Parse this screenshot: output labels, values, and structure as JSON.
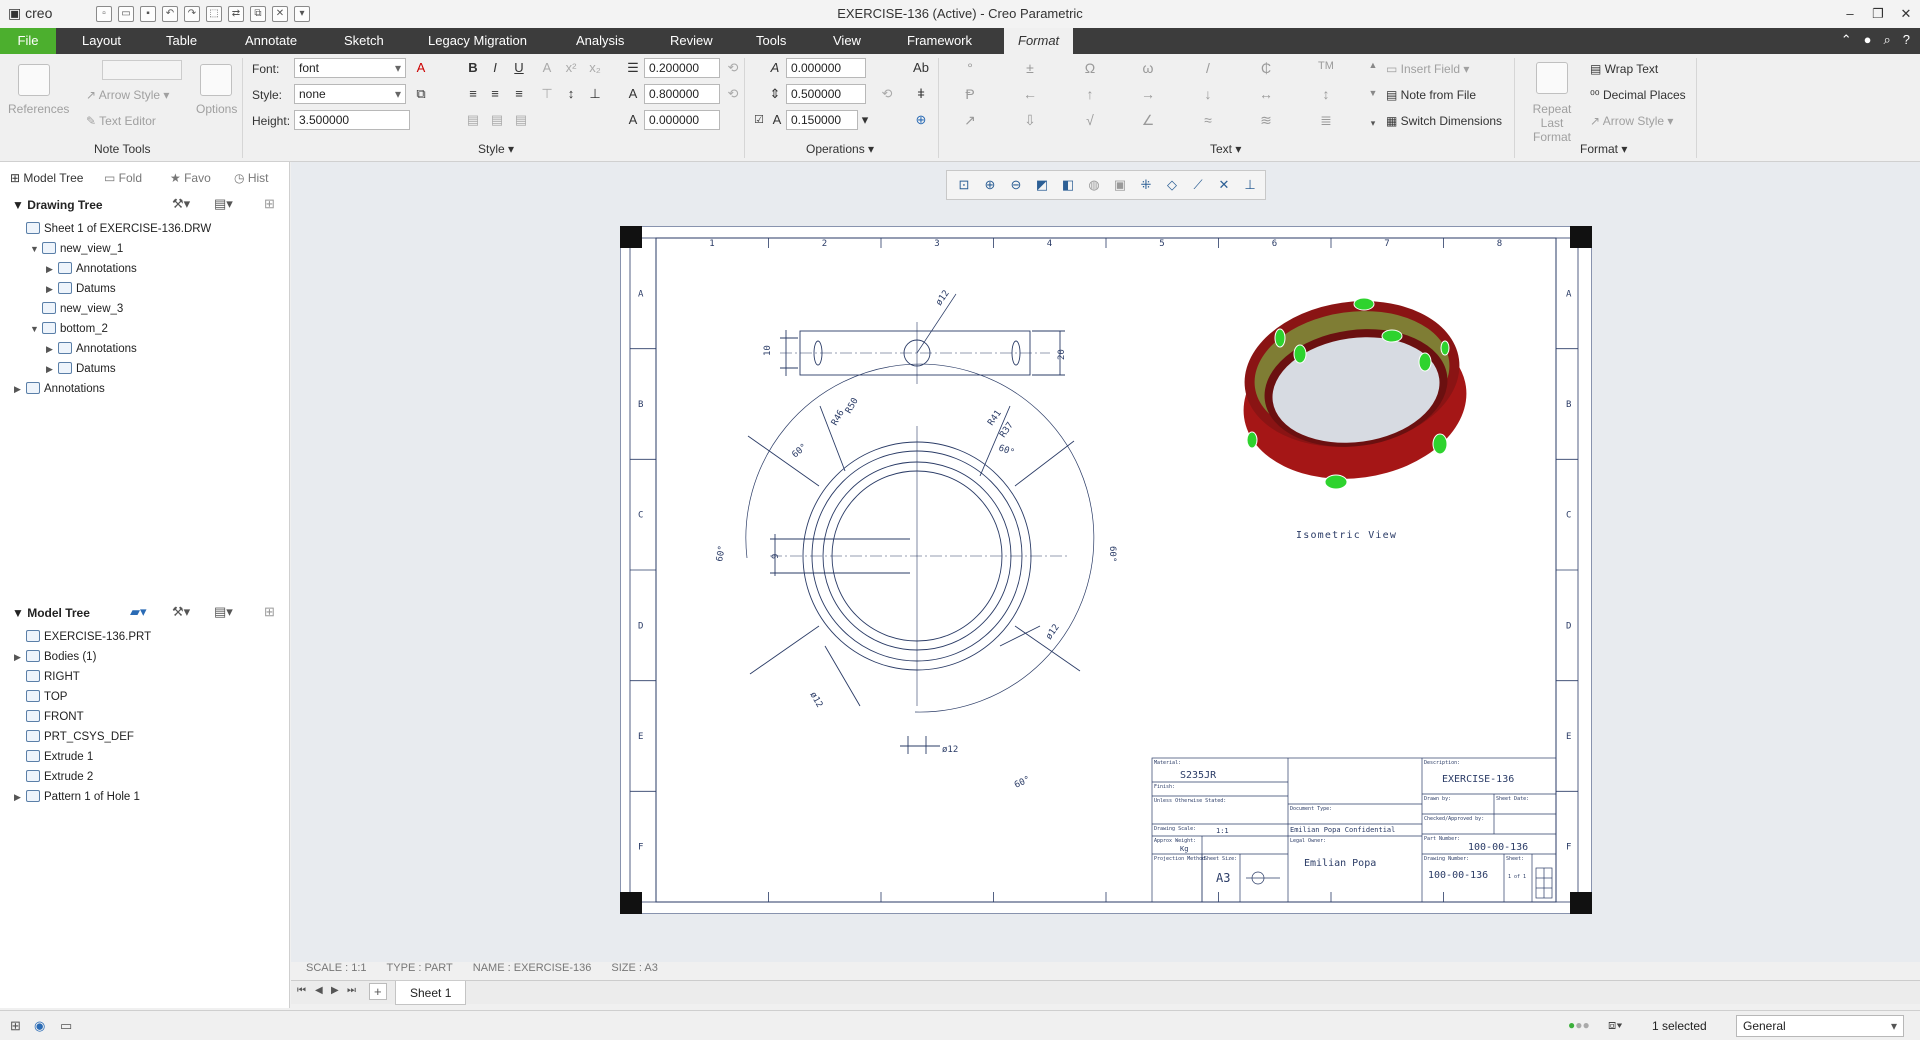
{
  "app": {
    "logo": "creo",
    "title": "EXERCISE-136 (Active) - Creo Parametric"
  },
  "menu": {
    "file": "File",
    "items": [
      "Layout",
      "Table",
      "Annotate",
      "Sketch",
      "Legacy Migration",
      "Analysis",
      "Review",
      "Tools",
      "View",
      "Framework"
    ],
    "active": "Format"
  },
  "ribbon": {
    "note_tools": {
      "label": "Note Tools",
      "references": "References",
      "arrow_style": "Arrow Style",
      "text_editor": "Text Editor",
      "options": "Options"
    },
    "style": {
      "label": "Style",
      "font_label": "Font:",
      "font_value": "font",
      "style_label": "Style:",
      "style_value": "none",
      "height_label": "Height:",
      "height_value": "3.500000"
    },
    "operations": {
      "label": "Operations",
      "thickness": "0.200000",
      "slant": "0.000000",
      "width_factor": "0.800000",
      "line_spacing": "0.500000",
      "char_spacing": "0.000000",
      "underline_offset": "0.150000"
    },
    "text": {
      "label": "Text",
      "insert_field": "Insert Field",
      "note_from_file": "Note from File",
      "switch_dimensions": "Switch Dimensions"
    },
    "format": {
      "label": "Format",
      "repeat_last_format": "Repeat Last Format",
      "wrap_text": "Wrap Text",
      "decimal_places": "Decimal Places",
      "arrow_style": "Arrow Style"
    }
  },
  "left_panel": {
    "tabs": [
      "Model Tree",
      "Fold",
      "Favo",
      "Hist"
    ],
    "drawing_tree": {
      "title": "Drawing Tree",
      "items": [
        {
          "label": "Sheet 1 of EXERCISE-136.DRW",
          "indent": 0,
          "arrow": ""
        },
        {
          "label": "new_view_1",
          "indent": 1,
          "arrow": "▼"
        },
        {
          "label": "Annotations",
          "indent": 2,
          "arrow": "▶"
        },
        {
          "label": "Datums",
          "indent": 2,
          "arrow": "▶"
        },
        {
          "label": "new_view_3",
          "indent": 1,
          "arrow": ""
        },
        {
          "label": "bottom_2",
          "indent": 1,
          "arrow": "▼"
        },
        {
          "label": "Annotations",
          "indent": 2,
          "arrow": "▶"
        },
        {
          "label": "Datums",
          "indent": 2,
          "arrow": "▶"
        },
        {
          "label": "Annotations",
          "indent": 0,
          "arrow": "▶"
        }
      ]
    },
    "model_tree": {
      "title": "Model Tree",
      "items": [
        {
          "label": "EXERCISE-136.PRT",
          "arrow": ""
        },
        {
          "label": "Bodies (1)",
          "arrow": "▶"
        },
        {
          "label": "RIGHT",
          "arrow": ""
        },
        {
          "label": "TOP",
          "arrow": ""
        },
        {
          "label": "FRONT",
          "arrow": ""
        },
        {
          "label": "PRT_CSYS_DEF",
          "arrow": ""
        },
        {
          "label": "Extrude 1",
          "arrow": ""
        },
        {
          "label": "Extrude 2",
          "arrow": ""
        },
        {
          "label": "Pattern 1 of Hole 1",
          "arrow": "▶"
        }
      ]
    }
  },
  "drawing": {
    "col_labels": [
      "1",
      "2",
      "3",
      "4",
      "5",
      "6",
      "7",
      "8"
    ],
    "row_labels": [
      "A",
      "B",
      "C",
      "D",
      "E",
      "F"
    ],
    "dims": {
      "top_dia": "ø12",
      "top_h10": "10",
      "top_h20": "20",
      "r50": "R50",
      "r46": "R46",
      "r41": "R41",
      "r37": "R37",
      "dia12_a": "ø12",
      "dia12_b": "ø12",
      "dia12_c": "ø12",
      "d9": "9",
      "ang1": "60°",
      "ang2": "60°",
      "ang3": "60°",
      "ang4": "60°",
      "ang5": "60°"
    },
    "iso_label": "Isometric View",
    "title_block": {
      "material_label": "Material:",
      "material": "S235JR",
      "finish_label": "Finish:",
      "notes": "Unless Otherwise Stated:",
      "scale_label": "Drawing Scale:",
      "scale": "1:1",
      "weight_label": "Approx Weight:",
      "weight_unit": "Kg",
      "projection_label": "Projection Method",
      "sheet_size_label": "Sheet Size:",
      "sheet_size": "A3",
      "doc_type_label": "Document Type:",
      "confidential": "Emilian Popa Confidential",
      "legal_owner_label": "Legal Owner:",
      "legal_owner": "Emilian Popa",
      "description_label": "Description:",
      "description": "EXERCISE-136",
      "drawn_by_label": "Drawn by:",
      "sheet_date_label": "Sheet Date:",
      "checked_label": "Checked/Approved by:",
      "part_number_label": "Part Number:",
      "part_number": "100-00-136",
      "drawing_number_label": "Drawing Number:",
      "drawing_number": "100-00-136",
      "sheet_label": "Sheet:",
      "sheet": "1 of 1"
    },
    "colors": {
      "ring_outer": "#b01818",
      "ring_inner": "#8a8a3a",
      "holes": "#2ed32e",
      "lines": "#2a3b66"
    }
  },
  "status": {
    "scale": "SCALE : 1:1",
    "type": "TYPE : PART",
    "name": "NAME : EXERCISE-136",
    "size": "SIZE : A3"
  },
  "sheet_tab": "Sheet 1",
  "bottom": {
    "selected": "1 selected",
    "filter": "General"
  }
}
